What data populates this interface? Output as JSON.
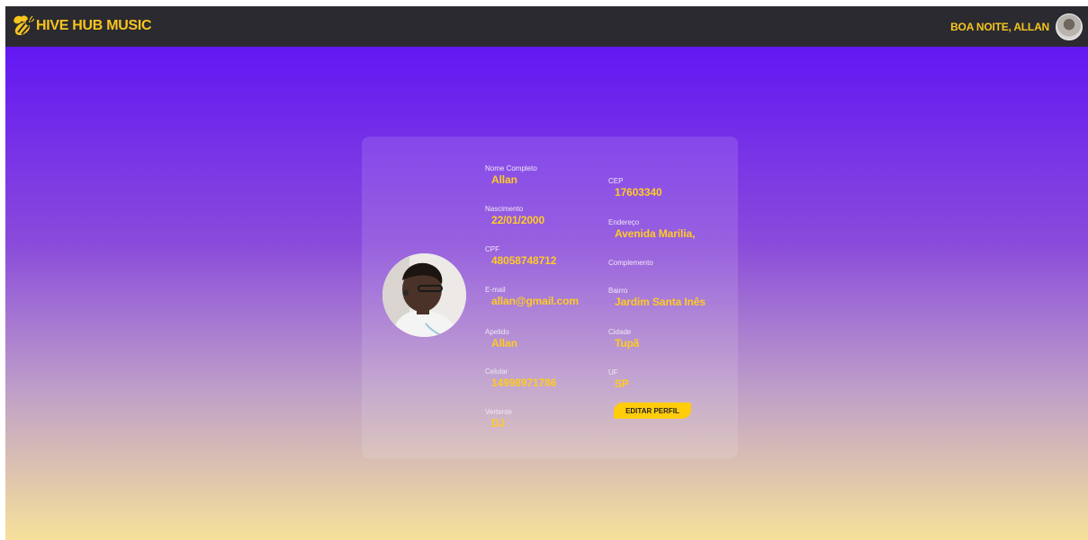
{
  "header": {
    "brand": "HIVE HUB MUSIC",
    "greeting": "BOA NOITE, ALLAN",
    "logo_icon": "bee-icon",
    "brand_color": "#f7c51e"
  },
  "profile": {
    "left_fields": [
      {
        "label": "Nome Completo",
        "value": "Allan"
      },
      {
        "label": "Nascimento",
        "value": "22/01/2000"
      },
      {
        "label": "CPF",
        "value": "48058748712"
      },
      {
        "label": "E-mail",
        "value": "allan@gmail.com"
      },
      {
        "label": "Apelido",
        "value": "Allan"
      },
      {
        "label": "Celular",
        "value": "14998971786"
      },
      {
        "label": "Vertente",
        "value": "DJ"
      }
    ],
    "right_fields": [
      {
        "label": "CEP",
        "value": "17603340"
      },
      {
        "label": "Endereço",
        "value": "Avenida Marilia,"
      },
      {
        "label": "Complemento",
        "value": ""
      },
      {
        "label": "Bairro",
        "value": "Jardim Santa Inês"
      },
      {
        "label": "Cidade",
        "value": "Tupã"
      },
      {
        "label": "UF",
        "value": "SP"
      }
    ],
    "edit_button": "EDITAR PERFIL"
  },
  "colors": {
    "topbar": "#2b2a30",
    "accent": "#ffcb24",
    "gradient_top": "#6217f3",
    "gradient_bottom": "#f6e19a"
  }
}
